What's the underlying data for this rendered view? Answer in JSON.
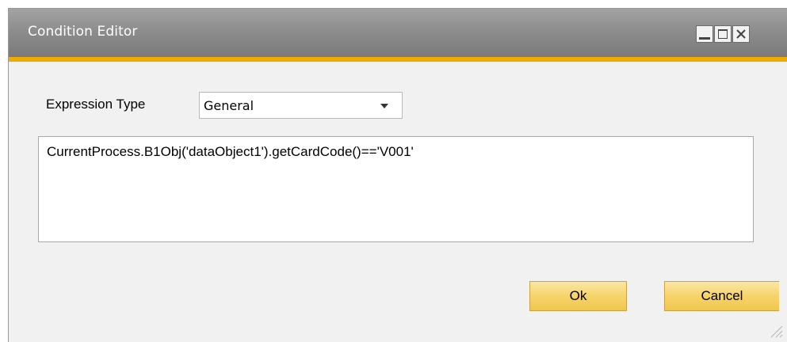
{
  "window": {
    "title": "Condition Editor",
    "accent_color": "#f0ab00",
    "controls": [
      "minimize-icon",
      "maximize-icon",
      "close-icon"
    ]
  },
  "form": {
    "expression_type_label": "Expression Type",
    "expression_type_value": "General",
    "expression_text": "CurrentProcess.B1Obj('dataObject1').getCardCode()=='V001'"
  },
  "buttons": {
    "ok_label": "Ok",
    "cancel_label": "Cancel",
    "button_color": "#f6d36a"
  }
}
